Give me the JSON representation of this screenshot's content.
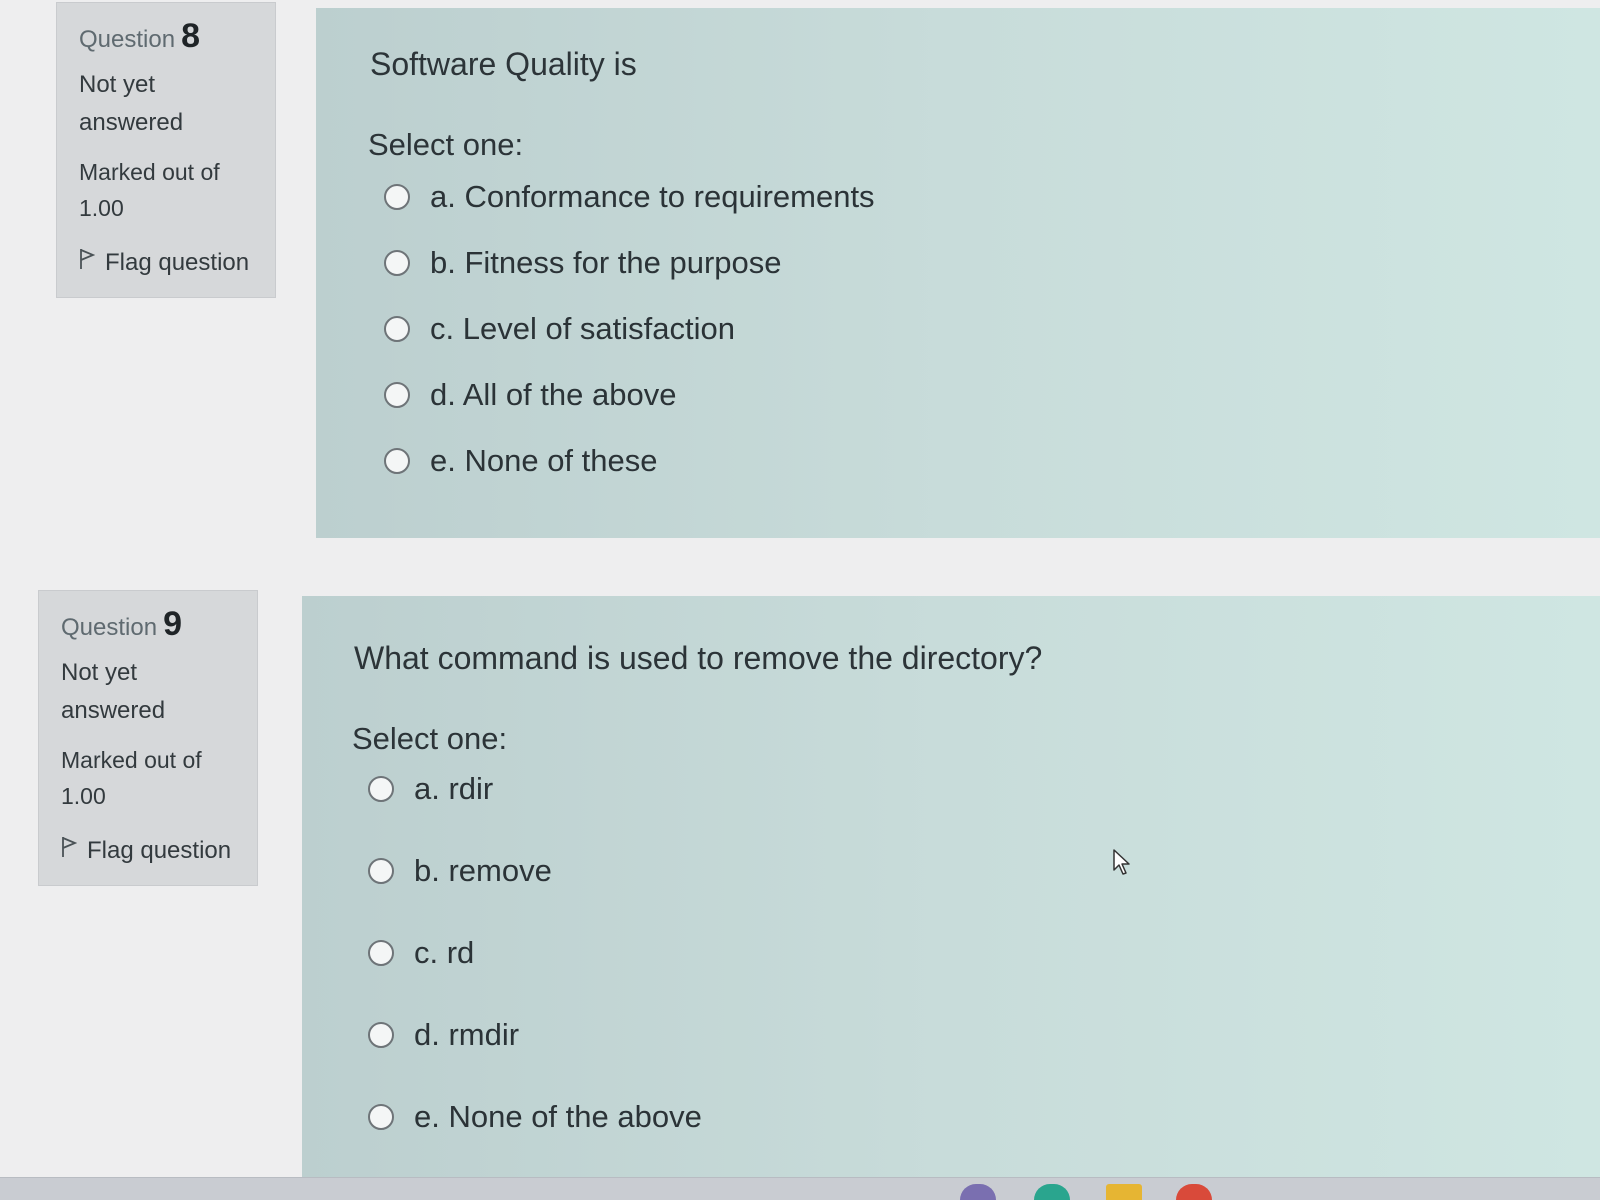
{
  "questions": [
    {
      "label": "Question",
      "number": "8",
      "state_line1": "Not yet",
      "state_line2": "answered",
      "mark_line1": "Marked out of",
      "mark_line2": "1.00",
      "flag_label": "Flag question",
      "text": "Software Quality is",
      "prompt": "Select one:",
      "options": [
        "a. Conformance to requirements",
        "b. Fitness for the purpose",
        "c. Level of satisfaction",
        "d. All of the above",
        "e. None of these"
      ]
    },
    {
      "label": "Question",
      "number": "9",
      "state_line1": "Not yet",
      "state_line2": "answered",
      "mark_line1": "Marked out of",
      "mark_line2": "1.00",
      "flag_label": "Flag question",
      "text": "What command is used to remove the directory?",
      "prompt": "Select one:",
      "options": [
        "a. rdir",
        "b. remove",
        "c. rd",
        "d. rmdir",
        "e. None of the above"
      ]
    }
  ],
  "icons": {
    "flag": "flag-icon",
    "radio": "radio-button",
    "cursor": "mouse-pointer-icon"
  },
  "colors": {
    "info_panel": "#d6d8da",
    "content_panel": "#c8dcda",
    "page": "#eeeeef"
  }
}
